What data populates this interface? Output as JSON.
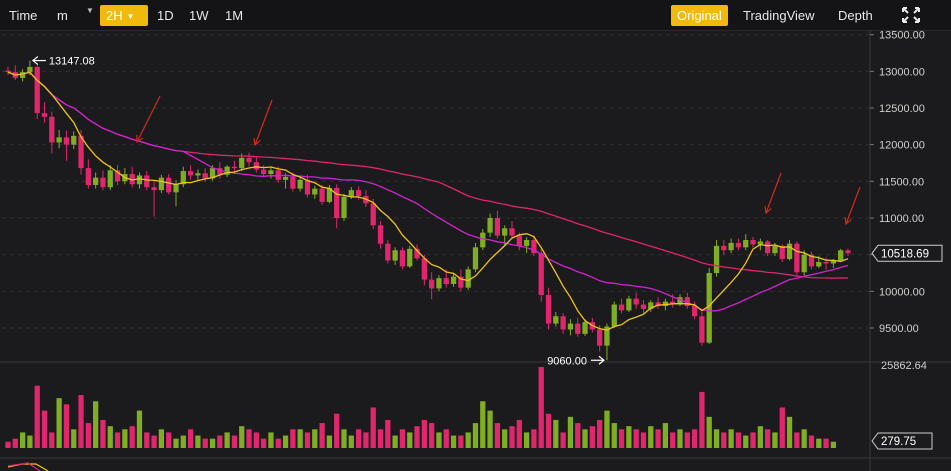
{
  "toolbar": {
    "time_label": "Time",
    "minutes_label": "m",
    "interval_selected": "2H",
    "intervals": [
      "1D",
      "1W",
      "1M"
    ],
    "views": [
      "Original",
      "TradingView",
      "Depth"
    ],
    "view_active": "Original",
    "accent_color": "#f0b90b",
    "fullscreen_icon": "expand-icon"
  },
  "chart_data": {
    "type": "candlestick",
    "price_axis_ticks": [
      13500,
      13000,
      12500,
      12000,
      11500,
      11000,
      10500,
      10000,
      9500
    ],
    "price_axis_labels": [
      "13500.00",
      "13000.00",
      "12500.00",
      "12000.00",
      "11500.00",
      "11000.00",
      "10500.00",
      "10000.00",
      "9500.00"
    ],
    "price_range": [
      9050,
      13550
    ],
    "current_price_label": "10518.69",
    "high_marker_label": "13147.08",
    "low_marker_label": "9060.00",
    "volume_max_label": "25862.64",
    "volume_current_label": "279.75",
    "up_color": "#7fae22",
    "down_color": "#e0276e",
    "ma_fast_color": "#f0c419",
    "ma_mid_color": "#d024d0",
    "ma_slow_color": "#e0246e",
    "ohlc": [
      [
        13010,
        13060,
        12950,
        12990
      ],
      [
        12990,
        13080,
        12880,
        12910
      ],
      [
        12910,
        13030,
        12860,
        12990
      ],
      [
        12990,
        13147,
        12950,
        13060
      ],
      [
        13060,
        13080,
        12350,
        12430
      ],
      [
        12430,
        12580,
        12300,
        12380
      ],
      [
        12380,
        12450,
        11880,
        12030
      ],
      [
        12030,
        12200,
        11950,
        12100
      ],
      [
        12100,
        12190,
        11780,
        12000
      ],
      [
        12000,
        12180,
        11940,
        12120
      ],
      [
        12120,
        12200,
        11590,
        11680
      ],
      [
        11680,
        11800,
        11400,
        11450
      ],
      [
        11450,
        11620,
        11400,
        11550
      ],
      [
        11550,
        11650,
        11380,
        11420
      ],
      [
        11420,
        11720,
        11380,
        11650
      ],
      [
        11650,
        11720,
        11450,
        11500
      ],
      [
        11500,
        11680,
        11460,
        11600
      ],
      [
        11600,
        11700,
        11420,
        11460
      ],
      [
        11460,
        11620,
        11400,
        11580
      ],
      [
        11580,
        11640,
        11380,
        11420
      ],
      [
        11420,
        11500,
        11020,
        11380
      ],
      [
        11380,
        11590,
        11340,
        11550
      ],
      [
        11550,
        11600,
        11320,
        11350
      ],
      [
        11350,
        11520,
        11160,
        11460
      ],
      [
        11460,
        11700,
        11420,
        11640
      ],
      [
        11640,
        11720,
        11520,
        11580
      ],
      [
        11580,
        11660,
        11500,
        11610
      ],
      [
        11610,
        11680,
        11500,
        11540
      ],
      [
        11540,
        11720,
        11510,
        11680
      ],
      [
        11680,
        11760,
        11540,
        11590
      ],
      [
        11590,
        11720,
        11560,
        11700
      ],
      [
        11700,
        11780,
        11600,
        11680
      ],
      [
        11680,
        11880,
        11640,
        11820
      ],
      [
        11820,
        11890,
        11700,
        11760
      ],
      [
        11760,
        11830,
        11620,
        11660
      ],
      [
        11660,
        11720,
        11560,
        11600
      ],
      [
        11600,
        11700,
        11540,
        11650
      ],
      [
        11650,
        11700,
        11480,
        11520
      ],
      [
        11520,
        11610,
        11400,
        11560
      ],
      [
        11560,
        11620,
        11360,
        11400
      ],
      [
        11400,
        11560,
        11360,
        11520
      ],
      [
        11520,
        11590,
        11280,
        11320
      ],
      [
        11320,
        11440,
        11260,
        11400
      ],
      [
        11400,
        11450,
        11180,
        11220
      ],
      [
        11220,
        11450,
        11200,
        11410
      ],
      [
        11410,
        11460,
        10860,
        11000
      ],
      [
        11000,
        11330,
        10960,
        11290
      ],
      [
        11290,
        11420,
        11260,
        11380
      ],
      [
        11380,
        11430,
        11250,
        11300
      ],
      [
        11300,
        11380,
        11150,
        11200
      ],
      [
        11200,
        11260,
        10850,
        10900
      ],
      [
        10900,
        10960,
        10580,
        10650
      ],
      [
        10650,
        10700,
        10380,
        10420
      ],
      [
        10420,
        10600,
        10360,
        10560
      ],
      [
        10560,
        10600,
        10300,
        10340
      ],
      [
        10340,
        10620,
        10320,
        10580
      ],
      [
        10580,
        10640,
        10420,
        10450
      ],
      [
        10450,
        10500,
        10080,
        10160
      ],
      [
        10160,
        10260,
        9890,
        10040
      ],
      [
        10040,
        10220,
        10000,
        10180
      ],
      [
        10180,
        10300,
        10050,
        10100
      ],
      [
        10100,
        10240,
        10060,
        10200
      ],
      [
        10200,
        10300,
        10000,
        10050
      ],
      [
        10050,
        10340,
        10020,
        10300
      ],
      [
        10300,
        10660,
        10260,
        10600
      ],
      [
        10600,
        10850,
        10560,
        10800
      ],
      [
        10800,
        11060,
        10740,
        11000
      ],
      [
        11000,
        11100,
        10720,
        10760
      ],
      [
        10760,
        10900,
        10620,
        10860
      ],
      [
        10860,
        10960,
        10720,
        10760
      ],
      [
        10760,
        10800,
        10560,
        10620
      ],
      [
        10620,
        10740,
        10520,
        10700
      ],
      [
        10700,
        10760,
        10480,
        10520
      ],
      [
        10520,
        10580,
        9860,
        9950
      ],
      [
        9950,
        10050,
        9480,
        9560
      ],
      [
        9560,
        9720,
        9520,
        9660
      ],
      [
        9660,
        9700,
        9420,
        9480
      ],
      [
        9480,
        9620,
        9400,
        9560
      ],
      [
        9560,
        9640,
        9380,
        9420
      ],
      [
        9420,
        9620,
        9390,
        9580
      ],
      [
        9580,
        9640,
        9440,
        9480
      ],
      [
        9480,
        9540,
        9180,
        9260
      ],
      [
        9260,
        9560,
        9060,
        9520
      ],
      [
        9520,
        9860,
        9500,
        9820
      ],
      [
        9820,
        9900,
        9700,
        9740
      ],
      [
        9740,
        9940,
        9720,
        9900
      ],
      [
        9900,
        9980,
        9760,
        9820
      ],
      [
        9820,
        9880,
        9700,
        9760
      ],
      [
        9760,
        9880,
        9720,
        9850
      ],
      [
        9850,
        9920,
        9760,
        9800
      ],
      [
        9800,
        9900,
        9740,
        9860
      ],
      [
        9860,
        9960,
        9780,
        9820
      ],
      [
        9820,
        9960,
        9800,
        9920
      ],
      [
        9920,
        9980,
        9760,
        9800
      ],
      [
        9800,
        9860,
        9620,
        9660
      ],
      [
        9660,
        9720,
        9260,
        9300
      ],
      [
        9300,
        10320,
        9280,
        10250
      ],
      [
        10250,
        10700,
        10200,
        10620
      ],
      [
        10620,
        10700,
        10500,
        10560
      ],
      [
        10560,
        10720,
        10520,
        10660
      ],
      [
        10660,
        10720,
        10560,
        10600
      ],
      [
        10600,
        10780,
        10560,
        10700
      ],
      [
        10700,
        10740,
        10600,
        10640
      ],
      [
        10640,
        10720,
        10560,
        10680
      ],
      [
        10680,
        10700,
        10480,
        10520
      ],
      [
        10520,
        10660,
        10480,
        10620
      ],
      [
        10620,
        10640,
        10400,
        10440
      ],
      [
        10440,
        10700,
        10420,
        10650
      ],
      [
        10650,
        10680,
        10200,
        10260
      ],
      [
        10260,
        10560,
        10220,
        10500
      ],
      [
        10500,
        10540,
        10300,
        10340
      ],
      [
        10340,
        10480,
        10320,
        10400
      ],
      [
        10400,
        10460,
        10300,
        10380
      ],
      [
        10380,
        10440,
        10320,
        10420
      ],
      [
        10420,
        10580,
        10400,
        10560
      ],
      [
        10560,
        10580,
        10480,
        10519
      ]
    ],
    "volume": [
      2,
      3,
      5,
      4,
      20,
      12,
      5,
      16,
      14,
      6,
      17,
      8,
      15,
      9,
      7,
      5,
      6,
      7,
      12,
      5,
      4,
      6,
      5,
      3,
      4,
      6,
      4,
      3,
      3,
      4,
      5,
      4,
      7,
      6,
      5,
      3,
      5,
      3,
      4,
      6,
      6,
      5,
      6,
      8,
      4,
      11,
      6,
      4,
      6,
      5,
      13,
      6,
      9,
      4,
      6,
      5,
      7,
      9,
      8,
      5,
      6,
      4,
      4,
      5,
      8,
      15,
      12,
      8,
      6,
      7,
      9,
      5,
      6,
      26,
      11,
      9,
      5,
      10,
      8,
      6,
      7,
      9,
      12,
      8,
      6,
      7,
      6,
      5,
      7,
      6,
      8,
      5,
      6,
      5,
      6,
      18,
      10,
      6,
      5,
      6,
      5,
      4,
      5,
      7,
      6,
      5,
      13,
      10,
      5,
      6,
      4,
      3,
      3,
      2
    ]
  }
}
